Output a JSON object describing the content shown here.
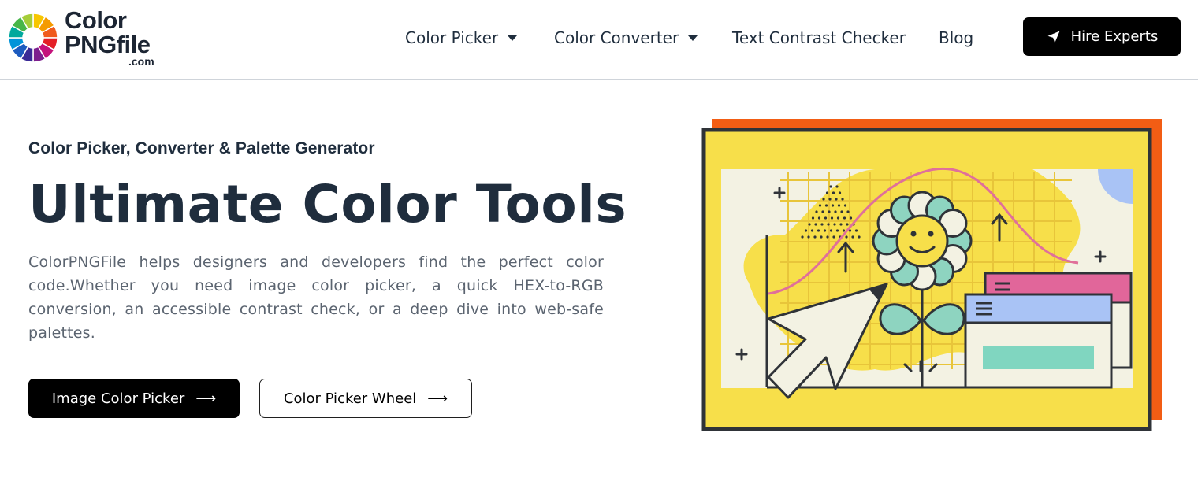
{
  "brand": {
    "logo_line1": "Color",
    "logo_line2": "PNGfile",
    "logo_suffix": ".com",
    "wheel_colors": [
      "#f7c600",
      "#f59b00",
      "#f05a1c",
      "#e41f26",
      "#c4127b",
      "#7d1f8e",
      "#3a2a96",
      "#1c5bbf",
      "#0094d9",
      "#00a99d",
      "#47b649",
      "#a5cd39"
    ]
  },
  "nav": {
    "items": [
      {
        "label": "Color Picker",
        "has_dropdown": true
      },
      {
        "label": "Color Converter",
        "has_dropdown": true
      },
      {
        "label": "Text Contrast Checker",
        "has_dropdown": false
      },
      {
        "label": "Blog",
        "has_dropdown": false
      }
    ],
    "cta_label": "Hire Experts",
    "cta_icon": "navigation-arrow-icon"
  },
  "hero": {
    "subtitle": "Color Picker, Converter & Palette Generator",
    "title": "Ultimate Color Tools",
    "description": "ColorPNGFile helps designers and developers find the perfect color code.Whether you need image color picker, a quick HEX-to-RGB conversion, an accessible contrast check, or a deep dive into web-safe palettes.",
    "primary_button": "Image Color Picker",
    "secondary_button": "Color Picker Wheel",
    "button_arrow": "⟶"
  },
  "illustration": {
    "name": "color-tools-illustration",
    "colors": {
      "frame_shadow": "#f25d14",
      "frame_bg": "#f7df4a",
      "panel_bg": "#f3f2e3",
      "outline": "#2f3338",
      "curve": "#e0709a",
      "petals": "#8ed4c0",
      "leaf": "#8ed4c0",
      "window_pink": "#e1669a",
      "window_blue": "#a9c3f5",
      "window_bar": "#80d6c0",
      "circle_blue": "#a9c3f5"
    }
  }
}
